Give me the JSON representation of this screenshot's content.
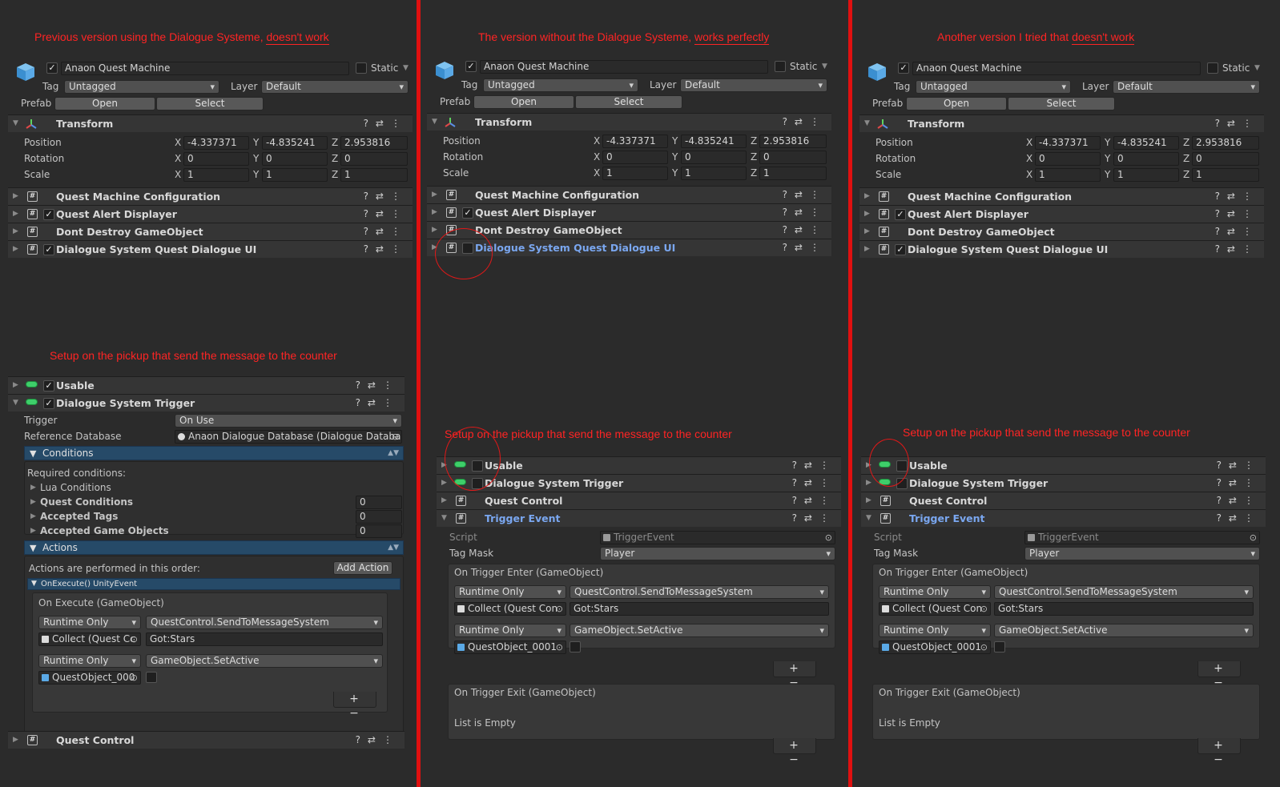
{
  "captions": {
    "left_top_pre": "Previous version using the Dialogue Systeme, ",
    "left_top_ul": "doesn't work",
    "mid_top_pre": "The version without the Dialogue Systeme, ",
    "mid_top_ul": "works perfectly",
    "right_top_pre": "Another version I tried that ",
    "right_top_ul": "doesn't work",
    "setup": "Setup on the pickup that send the message to the counter"
  },
  "gameobject": {
    "name": "Anaon Quest Machine",
    "static_label": "Static",
    "tag_label": "Tag",
    "tag_value": "Untagged",
    "layer_label": "Layer",
    "layer_value": "Default",
    "prefab_label": "Prefab",
    "open_label": "Open",
    "select_label": "Select"
  },
  "transform": {
    "title": "Transform",
    "position_label": "Position",
    "rotation_label": "Rotation",
    "scale_label": "Scale",
    "x": "X",
    "y": "Y",
    "z": "Z",
    "pos_x": "-4.337371",
    "pos_y": "-4.835241",
    "pos_z": "2.953816",
    "rot_x": "0",
    "rot_y": "0",
    "rot_z": "0",
    "scl_x": "1",
    "scl_y": "1",
    "scl_z": "1"
  },
  "components": {
    "qmc": "Quest Machine Configuration",
    "qad": "Quest Alert Displayer",
    "ddgo": "Dont Destroy GameObject",
    "dsqd": "Dialogue System Quest Dialogue UI",
    "usable": "Usable",
    "dst": "Dialogue System Trigger",
    "qc": "Quest Control",
    "te": "Trigger Event"
  },
  "trigger": {
    "trigger_label": "Trigger",
    "trigger_value": "On Use",
    "refdb_label": "Reference Database",
    "refdb_value": "Anaon Dialogue Database (Dialogue Databa",
    "conditions": "Conditions",
    "required": "Required conditions:",
    "lua": "Lua Conditions",
    "quest_cond": "Quest Conditions",
    "accepted_tags": "Accepted Tags",
    "accepted_go": "Accepted Game Objects",
    "zero": "0",
    "actions": "Actions",
    "actions_order": "Actions are performed in this order:",
    "add_action": "Add Action",
    "onexecute_unity": "OnExecute() UnityEvent",
    "onexecute": "On Execute (GameObject)",
    "runtime_only": "Runtime Only",
    "send_msg": "QuestControl.SendToMessageSystem",
    "collect_left": "Collect (Quest Cc",
    "got_stars": "Got:Stars",
    "set_active": "GameObject.SetActive",
    "questobj_left": "QuestObject_000"
  },
  "triggerevent": {
    "script_label": "Script",
    "script_value": "TriggerEvent",
    "tagmask_label": "Tag Mask",
    "tagmask_value": "Player",
    "enter": "On Trigger Enter (GameObject)",
    "collect": "Collect (Quest Con",
    "questobj": "QuestObject_0001",
    "exit": "On Trigger Exit (GameObject)",
    "empty": "List is Empty",
    "plus_minus": "+ −"
  }
}
